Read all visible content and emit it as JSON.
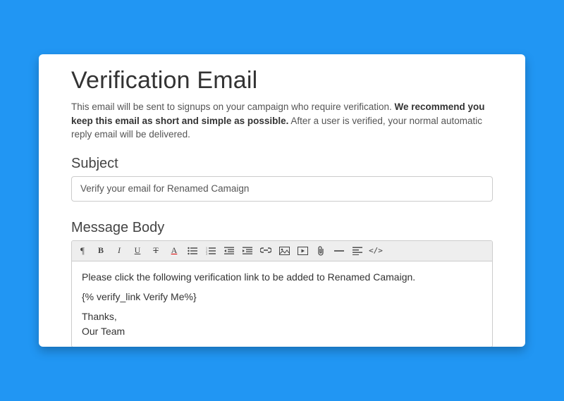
{
  "page": {
    "title": "Verification Email",
    "description_pre": "This email will be sent to signups on your campaign who require verification. ",
    "description_bold": "We recommend you keep this email as short and simple as possible.",
    "description_post": " After a user is verified, your normal automatic reply email will be delivered."
  },
  "subject": {
    "label": "Subject",
    "value": "Verify your email for Renamed Camaign"
  },
  "message": {
    "label": "Message Body",
    "body_line1": "Please click the following verification link to be added to Renamed Camaign.",
    "body_line2": "{% verify_link Verify Me%}",
    "body_line3": "Thanks,",
    "body_line4": "Our Team"
  },
  "toolbar": {
    "paragraph": "¶",
    "bold": "B",
    "italic": "I",
    "underline": "U",
    "strike": "T",
    "color": "A"
  }
}
